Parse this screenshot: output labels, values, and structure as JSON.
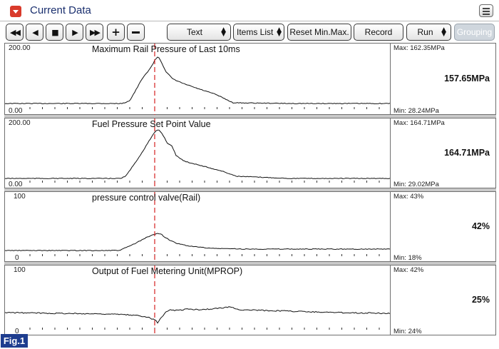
{
  "window": {
    "title": "Current Data"
  },
  "toolbar": {
    "text_select": "Text",
    "items_list": "Items List",
    "reset": "Reset Min.Max.",
    "record": "Record",
    "run_select": "Run",
    "grouping": "Grouping"
  },
  "cursor_color": "#d62020",
  "panels": [
    {
      "title": "Maximum Rail Pressure of Last 10ms",
      "ymax": "200.00",
      "ymin": "0.00",
      "max": "Max: 162.35MPa",
      "min": "Min:  28.24MPa",
      "value": "157.65MPa"
    },
    {
      "title": "Fuel Pressure Set Point Value",
      "ymax": "200.00",
      "ymin": "0.00",
      "max": "Max: 164.71MPa",
      "min": "Min: 29.02MPa",
      "value": "164.71MPa"
    },
    {
      "title": "pressure control valve(Rail)",
      "ymax": "100",
      "ymin": "0",
      "max": "Max:    43%",
      "min": "Min:    18%",
      "value": "42%"
    },
    {
      "title": "Output of Fuel Metering Unit(MPROP)",
      "ymax": "100",
      "ymin": "0",
      "max": "Max:    42%",
      "min": "Min:    24%",
      "value": "25%"
    }
  ],
  "figure_label": "Fig.1"
}
